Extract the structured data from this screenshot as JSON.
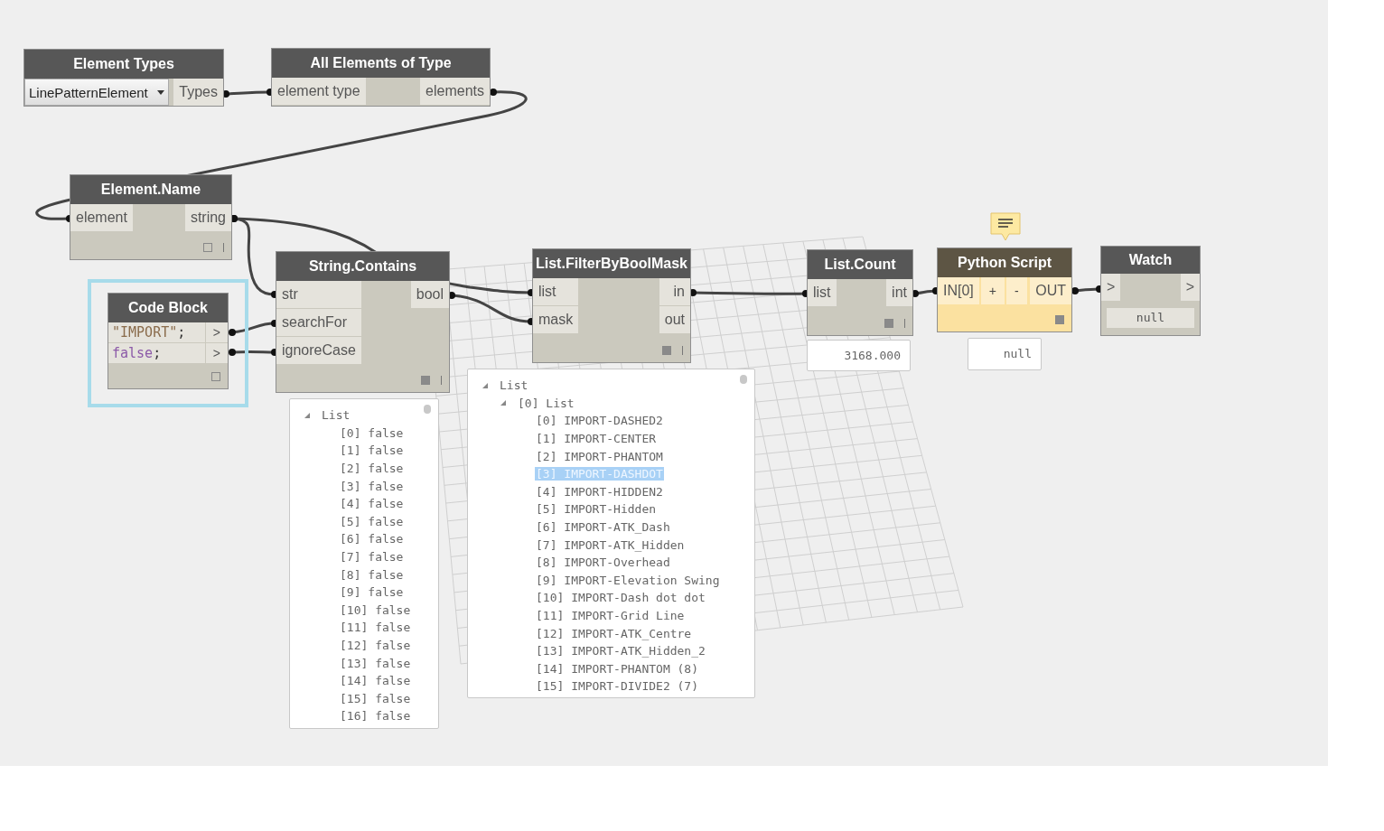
{
  "nodes": [
    {
      "kind": "selector",
      "title": "Element Types",
      "selected": false,
      "dropdown": "LinePatternElement",
      "outputs": [
        "Types"
      ]
    },
    {
      "kind": "standard",
      "title": "All Elements of Type",
      "selected": false,
      "inputs": [
        "element type"
      ],
      "outputs": [
        "elements"
      ]
    },
    {
      "kind": "standard",
      "title": "Element.Name",
      "selected": false,
      "inputs": [
        "element"
      ],
      "outputs": [
        "string"
      ],
      "preview_pinned": false
    },
    {
      "kind": "code",
      "title": "Code Block",
      "selected": true,
      "lines": [
        {
          "token": "\"IMPORT\"",
          "kind": "string",
          "end": ";"
        },
        {
          "token": "false",
          "kind": "keyword",
          "end": ";"
        }
      ],
      "outputs": [
        ">",
        ">"
      ],
      "preview_pinned": false
    },
    {
      "kind": "standard",
      "title": "String.Contains",
      "selected": false,
      "inputs": [
        "str",
        "searchFor",
        "ignoreCase"
      ],
      "outputs": [
        "bool"
      ],
      "preview_pinned": true,
      "preview_tree": {
        "label": "List",
        "expanded": true,
        "children": [
          {
            "label": "[0] false",
            "selected": false
          },
          {
            "label": "[1] false",
            "selected": false
          },
          {
            "label": "[2] false",
            "selected": false
          },
          {
            "label": "[3] false",
            "selected": false
          },
          {
            "label": "[4] false",
            "selected": false
          },
          {
            "label": "[5] false",
            "selected": false
          },
          {
            "label": "[6] false",
            "selected": false
          },
          {
            "label": "[7] false",
            "selected": false
          },
          {
            "label": "[8] false",
            "selected": false
          },
          {
            "label": "[9] false",
            "selected": false
          },
          {
            "label": "[10] false",
            "selected": false
          },
          {
            "label": "[11] false",
            "selected": false
          },
          {
            "label": "[12] false",
            "selected": false
          },
          {
            "label": "[13] false",
            "selected": false
          },
          {
            "label": "[14] false",
            "selected": false
          },
          {
            "label": "[15] false",
            "selected": false
          },
          {
            "label": "[16] false",
            "selected": false
          }
        ]
      }
    },
    {
      "kind": "standard",
      "title": "List.FilterByBoolMask",
      "selected": false,
      "inputs": [
        "list",
        "mask"
      ],
      "outputs": [
        "in",
        "out"
      ],
      "preview_pinned": true,
      "preview_tree": {
        "label": "List",
        "expanded": true,
        "children": [
          {
            "label": "[0] List",
            "expanded": true,
            "children": [
              {
                "label": "[0] IMPORT-DASHED2",
                "selected": false
              },
              {
                "label": "[1] IMPORT-CENTER",
                "selected": false
              },
              {
                "label": "[2] IMPORT-PHANTOM",
                "selected": false
              },
              {
                "label": "[3] IMPORT-DASHDOT",
                "selected": true
              },
              {
                "label": "[4] IMPORT-HIDDEN2",
                "selected": false
              },
              {
                "label": "[5] IMPORT-Hidden",
                "selected": false
              },
              {
                "label": "[6] IMPORT-ATK_Dash",
                "selected": false
              },
              {
                "label": "[7] IMPORT-ATK_Hidden",
                "selected": false
              },
              {
                "label": "[8] IMPORT-Overhead",
                "selected": false
              },
              {
                "label": "[9] IMPORT-Elevation Swing",
                "selected": false
              },
              {
                "label": "[10] IMPORT-Dash dot dot",
                "selected": false
              },
              {
                "label": "[11] IMPORT-Grid Line",
                "selected": false
              },
              {
                "label": "[12] IMPORT-ATK_Centre",
                "selected": false
              },
              {
                "label": "[13] IMPORT-ATK_Hidden_2",
                "selected": false
              },
              {
                "label": "[14] IMPORT-PHANTOM (8)",
                "selected": false
              },
              {
                "label": "[15] IMPORT-DIVIDE2 (7)",
                "selected": false
              }
            ]
          }
        ]
      }
    },
    {
      "kind": "standard",
      "title": "List.Count",
      "selected": false,
      "inputs": [
        "list"
      ],
      "outputs": [
        "int"
      ],
      "preview_pinned": true,
      "preview": "3168.000"
    },
    {
      "kind": "python",
      "title": "Python Script",
      "selected": false,
      "inputs": [
        "IN[0]"
      ],
      "buttons": [
        "+",
        "-"
      ],
      "outputs": [
        "OUT"
      ],
      "preview_pinned": true,
      "preview": "null"
    },
    {
      "kind": "watch",
      "title": "Watch",
      "selected": false,
      "inputs": [
        ">"
      ],
      "outputs": [
        ">"
      ],
      "value": "null"
    }
  ]
}
